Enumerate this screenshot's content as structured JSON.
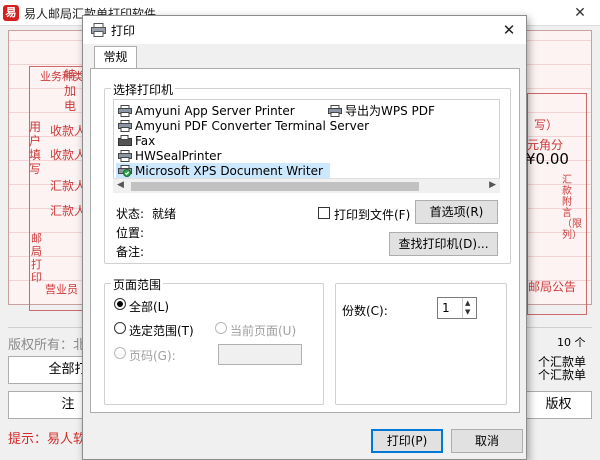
{
  "app": {
    "title": "易人邮局汇款单打印软件",
    "logo_char": "易",
    "close_glyph": "✕",
    "form": {
      "left_labels_top": "业务种类",
      "field_labels": [
        "特",
        "加",
        "电"
      ],
      "labels_right": [
        "收款人",
        "收款人",
        "汇款人",
        "汇款人"
      ],
      "left_column_labels": [
        "用户填写",
        "邮局打印"
      ],
      "bottom_label": "营业员",
      "right_labels": [
        "写）",
        "元角分"
      ],
      "amount": "¥0.00",
      "right_vertical_label": "汇款附言（限列）",
      "right_bottom_label": "邮局公告"
    },
    "copyright": "版权所有：北",
    "page_number": "10 个",
    "buttons": {
      "print_all": "全部打",
      "note": "注",
      "single_top": "个汇款单",
      "single_bottom": "个汇款单",
      "rights": "版权"
    },
    "hint": "提示：易人软件"
  },
  "dialog": {
    "title": "打印",
    "close_glyph": "✕",
    "tab": "常规",
    "select_printer_label": "选择打印机",
    "printers": [
      {
        "name": "Amyuni App Server Printer",
        "icon": "printer-icon"
      },
      {
        "name": "Amyuni PDF Converter Terminal Server",
        "icon": "printer-icon"
      },
      {
        "name": "Fax",
        "icon": "fax-icon"
      },
      {
        "name": "HWSealPrinter",
        "icon": "printer-icon"
      },
      {
        "name": "Microsoft XPS Document Writer",
        "icon": "printer-default-icon",
        "selected": true
      },
      {
        "name": "导出为WPS PDF",
        "icon": "printer-icon"
      }
    ],
    "status": {
      "label": "状态:",
      "value": "就绪"
    },
    "location": {
      "label": "位置:"
    },
    "comment": {
      "label": "备注:"
    },
    "print_to_file": "打印到文件(F)",
    "preferences_button": "首选项(R)",
    "find_printer_button": "查找打印机(D)...",
    "page_range": {
      "label": "页面范围",
      "all": "全部(L)",
      "selection": "选定范围(T)",
      "current_page": "当前页面(U)",
      "pages": "页码(G):"
    },
    "copies": {
      "label": "份数(C):",
      "value": "1"
    },
    "print_button": "打印(P)",
    "cancel_button": "取消"
  }
}
